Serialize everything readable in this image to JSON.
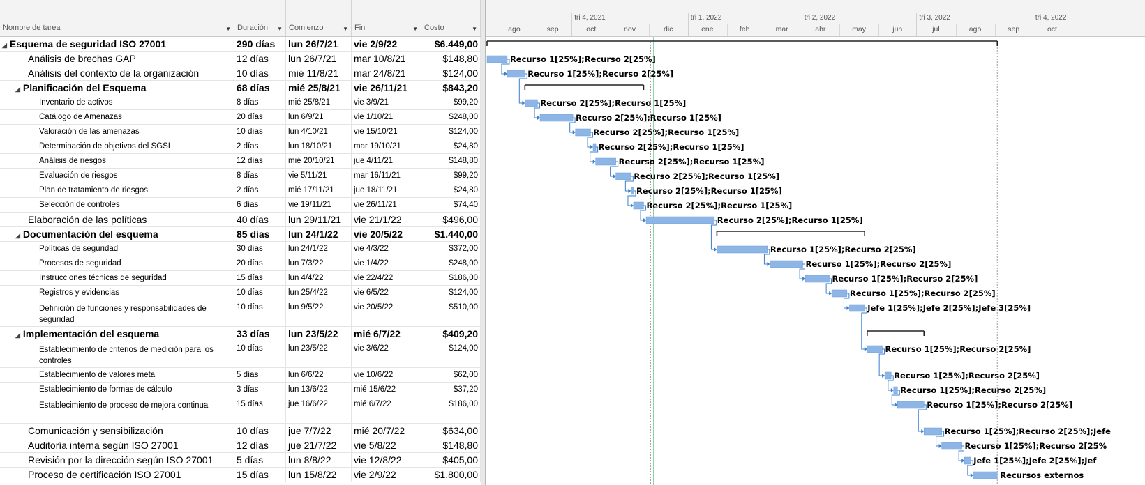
{
  "columns": {
    "name": "Nombre de tarea",
    "duration": "Duración",
    "start": "Comienzo",
    "finish": "Fin",
    "cost": "Costo"
  },
  "timescale": {
    "quarters": [
      "tri 4, 2021",
      "tri 1, 2022",
      "tri 2, 2022",
      "tri 3, 2022",
      "tri 4, 2022"
    ],
    "months": [
      "ago",
      "sep",
      "oct",
      "nov",
      "dic",
      "ene",
      "feb",
      "mar",
      "abr",
      "may",
      "jun",
      "jul",
      "ago",
      "sep",
      "oct"
    ]
  },
  "tasks": [
    {
      "name": "Esquema de seguridad ISO 27001",
      "dur": "290 días",
      "start": "lun 26/7/21",
      "finish": "vie 2/9/22",
      "cost": "$6.449,00",
      "level": 0,
      "summary": true,
      "s": "2021-07-26",
      "e": "2022-09-02",
      "res": ""
    },
    {
      "name": "Análisis de brechas GAP",
      "dur": "12 días",
      "start": "lun 26/7/21",
      "finish": "mar 10/8/21",
      "cost": "$148,80",
      "level": 1,
      "summary": false,
      "s": "2021-07-26",
      "e": "2021-08-10",
      "res": "Recurso 1[25%];Recurso 2[25%]"
    },
    {
      "name": "Análisis del contexto de la organización",
      "dur": "10 días",
      "start": "mié 11/8/21",
      "finish": "mar 24/8/21",
      "cost": "$124,00",
      "level": 1,
      "summary": false,
      "s": "2021-08-11",
      "e": "2021-08-24",
      "res": "Recurso 1[25%];Recurso 2[25%]"
    },
    {
      "name": "Planificación del Esquema",
      "dur": "68 días",
      "start": "mié 25/8/21",
      "finish": "vie 26/11/21",
      "cost": "$843,20",
      "level": 1,
      "summary": true,
      "s": "2021-08-25",
      "e": "2021-11-26",
      "res": ""
    },
    {
      "name": "Inventario de activos",
      "dur": "8 días",
      "start": "mié 25/8/21",
      "finish": "vie 3/9/21",
      "cost": "$99,20",
      "level": 2,
      "summary": false,
      "s": "2021-08-25",
      "e": "2021-09-03",
      "res": "Recurso 2[25%];Recurso 1[25%]"
    },
    {
      "name": "Catálogo de Amenazas",
      "dur": "20 días",
      "start": "lun 6/9/21",
      "finish": "vie 1/10/21",
      "cost": "$248,00",
      "level": 2,
      "summary": false,
      "s": "2021-09-06",
      "e": "2021-10-01",
      "res": "Recurso 2[25%];Recurso 1[25%]"
    },
    {
      "name": "Valoración de las amenazas",
      "dur": "10 días",
      "start": "lun 4/10/21",
      "finish": "vie 15/10/21",
      "cost": "$124,00",
      "level": 2,
      "summary": false,
      "s": "2021-10-04",
      "e": "2021-10-15",
      "res": "Recurso 2[25%];Recurso 1[25%]"
    },
    {
      "name": "Determinación de objetivos del SGSI",
      "dur": "2 días",
      "start": "lun 18/10/21",
      "finish": "mar 19/10/21",
      "cost": "$24,80",
      "level": 2,
      "summary": false,
      "s": "2021-10-18",
      "e": "2021-10-19",
      "res": "Recurso 2[25%];Recurso 1[25%]"
    },
    {
      "name": "Análisis de riesgos",
      "dur": "12 días",
      "start": "mié 20/10/21",
      "finish": "jue 4/11/21",
      "cost": "$148,80",
      "level": 2,
      "summary": false,
      "s": "2021-10-20",
      "e": "2021-11-04",
      "res": "Recurso 2[25%];Recurso 1[25%]"
    },
    {
      "name": "Evaluación de riesgos",
      "dur": "8 días",
      "start": "vie 5/11/21",
      "finish": "mar 16/11/21",
      "cost": "$99,20",
      "level": 2,
      "summary": false,
      "s": "2021-11-05",
      "e": "2021-11-16",
      "res": "Recurso 2[25%];Recurso 1[25%]"
    },
    {
      "name": "Plan de tratamiento de riesgos",
      "dur": "2 días",
      "start": "mié 17/11/21",
      "finish": "jue 18/11/21",
      "cost": "$24,80",
      "level": 2,
      "summary": false,
      "s": "2021-11-17",
      "e": "2021-11-18",
      "res": "Recurso 2[25%];Recurso 1[25%]"
    },
    {
      "name": "Selección de controles",
      "dur": "6 días",
      "start": "vie 19/11/21",
      "finish": "vie 26/11/21",
      "cost": "$74,40",
      "level": 2,
      "summary": false,
      "s": "2021-11-19",
      "e": "2021-11-26",
      "res": "Recurso 2[25%];Recurso 1[25%]"
    },
    {
      "name": "Elaboración de las políticas",
      "dur": "40 días",
      "start": "lun 29/11/21",
      "finish": "vie 21/1/22",
      "cost": "$496,00",
      "level": 1,
      "summary": false,
      "s": "2021-11-29",
      "e": "2022-01-21",
      "res": "Recurso 2[25%];Recurso 1[25%]"
    },
    {
      "name": "Documentación del esquema",
      "dur": "85 días",
      "start": "lun 24/1/22",
      "finish": "vie 20/5/22",
      "cost": "$1.440,00",
      "level": 1,
      "summary": true,
      "s": "2022-01-24",
      "e": "2022-05-20",
      "res": ""
    },
    {
      "name": "Políticas de seguridad",
      "dur": "30 días",
      "start": "lun 24/1/22",
      "finish": "vie 4/3/22",
      "cost": "$372,00",
      "level": 2,
      "summary": false,
      "s": "2022-01-24",
      "e": "2022-03-04",
      "res": "Recurso 1[25%];Recurso 2[25%]"
    },
    {
      "name": "Procesos de seguridad",
      "dur": "20 días",
      "start": "lun 7/3/22",
      "finish": "vie 1/4/22",
      "cost": "$248,00",
      "level": 2,
      "summary": false,
      "s": "2022-03-07",
      "e": "2022-04-01",
      "res": "Recurso 1[25%];Recurso 2[25%]"
    },
    {
      "name": "Instrucciones técnicas de seguridad",
      "dur": "15 días",
      "start": "lun 4/4/22",
      "finish": "vie 22/4/22",
      "cost": "$186,00",
      "level": 2,
      "summary": false,
      "s": "2022-04-04",
      "e": "2022-04-22",
      "res": "Recurso 1[25%];Recurso 2[25%]"
    },
    {
      "name": "Registros y evidencias",
      "dur": "10 días",
      "start": "lun 25/4/22",
      "finish": "vie 6/5/22",
      "cost": "$124,00",
      "level": 2,
      "summary": false,
      "s": "2022-04-25",
      "e": "2022-05-06",
      "res": "Recurso 1[25%];Recurso 2[25%]"
    },
    {
      "name": "Definición de funciones y responsabilidades de seguridad",
      "dur": "10 días",
      "start": "lun 9/5/22",
      "finish": "vie 20/5/22",
      "cost": "$510,00",
      "level": 2,
      "summary": false,
      "s": "2022-05-09",
      "e": "2022-05-20",
      "res": "Jefe 1[25%];Jefe 2[25%];Jefe 3[25%]"
    },
    {
      "name": "Implementación del esquema",
      "dur": "33 días",
      "start": "lun 23/5/22",
      "finish": "mié 6/7/22",
      "cost": "$409,20",
      "level": 1,
      "summary": true,
      "s": "2022-05-23",
      "e": "2022-07-06",
      "res": ""
    },
    {
      "name": "Establecimiento de criterios de medición para los controles",
      "dur": "10 días",
      "start": "lun 23/5/22",
      "finish": "vie 3/6/22",
      "cost": "$124,00",
      "level": 2,
      "summary": false,
      "s": "2022-05-23",
      "e": "2022-06-03",
      "res": "Recurso 1[25%];Recurso 2[25%]"
    },
    {
      "name": "Establecimiento de valores meta",
      "dur": "5 días",
      "start": "lun 6/6/22",
      "finish": "vie 10/6/22",
      "cost": "$62,00",
      "level": 2,
      "summary": false,
      "s": "2022-06-06",
      "e": "2022-06-10",
      "res": "Recurso 1[25%];Recurso 2[25%]"
    },
    {
      "name": "Establecimiento de formas de cálculo",
      "dur": "3 días",
      "start": "lun 13/6/22",
      "finish": "mié 15/6/22",
      "cost": "$37,20",
      "level": 2,
      "summary": false,
      "s": "2022-06-13",
      "e": "2022-06-15",
      "res": "Recurso 1[25%];Recurso 2[25%]"
    },
    {
      "name": "Establecimiento de proceso de mejora continua",
      "dur": "15 días",
      "start": "jue 16/6/22",
      "finish": "mié 6/7/22",
      "cost": "$186,00",
      "level": 2,
      "summary": false,
      "s": "2022-06-16",
      "e": "2022-07-06",
      "res": "Recurso 1[25%];Recurso 2[25%]"
    },
    {
      "name": "Comunicación y sensibilización",
      "dur": "10 días",
      "start": "jue 7/7/22",
      "finish": "mié 20/7/22",
      "cost": "$634,00",
      "level": 1,
      "summary": false,
      "s": "2022-07-07",
      "e": "2022-07-20",
      "res": "Recurso 1[25%];Recurso 2[25%];Jefe"
    },
    {
      "name": "Auditoría interna según ISO 27001",
      "dur": "12 días",
      "start": "jue 21/7/22",
      "finish": "vie 5/8/22",
      "cost": "$148,80",
      "level": 1,
      "summary": false,
      "s": "2022-07-21",
      "e": "2022-08-05",
      "res": "Recurso 1[25%];Recurso 2[25%"
    },
    {
      "name": "Revisión por la dirección según ISO 27001",
      "dur": "5 días",
      "start": "lun 8/8/22",
      "finish": "vie 12/8/22",
      "cost": "$405,00",
      "level": 1,
      "summary": false,
      "s": "2022-08-08",
      "e": "2022-08-12",
      "res": "Jefe 1[25%];Jefe 2[25%];Jef"
    },
    {
      "name": "Proceso de certificación ISO 27001",
      "dur": "15 días",
      "start": "lun 15/8/22",
      "finish": "vie 2/9/22",
      "cost": "$1.800,00",
      "level": 1,
      "summary": false,
      "s": "2022-08-15",
      "e": "2022-09-02",
      "res": "Recursos externos"
    }
  ],
  "colors": {
    "bar": "#8db6e6",
    "barEdge": "#6a9bd8",
    "link": "#3a7fd0",
    "summary": "#222222",
    "today": "#3cb371"
  }
}
